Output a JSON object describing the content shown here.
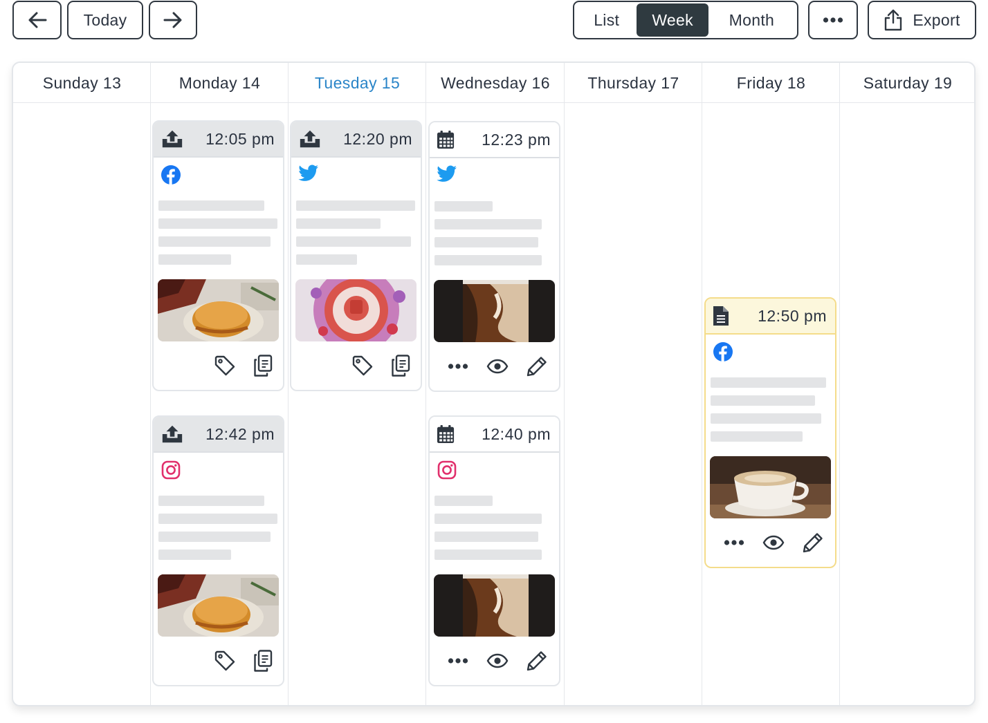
{
  "toolbar": {
    "prev_icon": "arrow-left-icon",
    "today_label": "Today",
    "next_icon": "arrow-right-icon",
    "views": [
      "List",
      "Week",
      "Month"
    ],
    "active_view": "Week",
    "more_icon": "ellipsis-icon",
    "export_label": "Export",
    "export_icon": "share-upload-icon"
  },
  "days": [
    {
      "label": "Sunday 13",
      "today": false
    },
    {
      "label": "Monday 14",
      "today": false
    },
    {
      "label": "Tuesday 15",
      "today": true
    },
    {
      "label": "Wednesday 16",
      "today": false
    },
    {
      "label": "Thursday 17",
      "today": false
    },
    {
      "label": "Friday 18",
      "today": false
    },
    {
      "label": "Saturday 19",
      "today": false
    }
  ],
  "posts": {
    "mon_1": {
      "time": "12:05 pm",
      "status": "published",
      "network": "facebook",
      "image": "sandwich-on-table"
    },
    "tue_1": {
      "time": "12:20 pm",
      "status": "published",
      "network": "twitter",
      "image": "strawberry-drink-flower"
    },
    "wed_1": {
      "time": "12:23 pm",
      "status": "scheduled",
      "network": "twitter",
      "image": "iced-coffee"
    },
    "mon_2": {
      "time": "12:42 pm",
      "status": "published",
      "network": "instagram",
      "image": "sandwich-on-table"
    },
    "wed_2": {
      "time": "12:40 pm",
      "status": "scheduled",
      "network": "instagram",
      "image": "iced-coffee"
    },
    "fri_1": {
      "time": "12:50 pm",
      "status": "draft",
      "network": "facebook",
      "image": "latte-cup"
    }
  },
  "colors": {
    "accent_today": "#2a85c8",
    "active_view_bg": "#2f3a40",
    "draft_border": "#f4dc8a",
    "facebook": "#1877f2",
    "twitter": "#1d9bf0",
    "instagram": "#e1306c"
  }
}
